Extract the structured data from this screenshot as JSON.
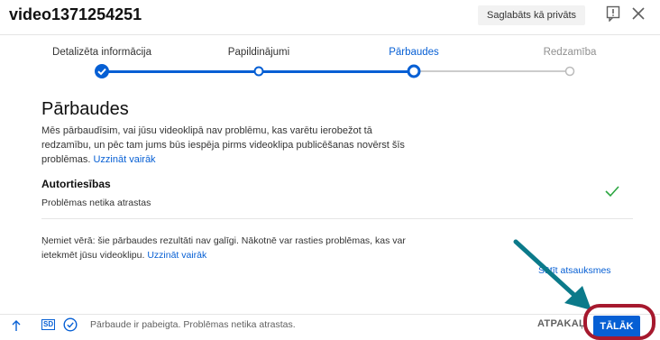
{
  "header": {
    "title": "video1371254251",
    "saved_badge": "Saglabāts kā privāts"
  },
  "stepper": {
    "steps": [
      {
        "label": "Detalizēta informācija",
        "state": "done"
      },
      {
        "label": "Papildinājumi",
        "state": "done"
      },
      {
        "label": "Pārbaudes",
        "state": "active"
      },
      {
        "label": "Redzamība",
        "state": "disabled"
      }
    ]
  },
  "checks": {
    "title": "Pārbaudes",
    "intro": "Mēs pārbaudīsim, vai jūsu videoklipā nav problēmu, kas varētu ierobežot tā redzamību, un pēc tam jums būs iespēja pirms videoklipa publicēšanas novērst šīs problēmas.",
    "intro_link": "Uzzināt vairāk",
    "copyright_title": "Autortiesības",
    "copyright_status": "Problēmas netika atrastas",
    "note": "Ņemiet vērā: šie pārbaudes rezultāti nav galīgi. Nākotnē var rasties problēmas, kas var ietekmēt jūsu videoklipu.",
    "note_link": "Uzzināt vairāk",
    "feedback_link": "Sūtīt atsauksmes"
  },
  "footer": {
    "sd_badge": "SD",
    "status": "Pārbaude ir pabeigta. Problēmas netika atrastas.",
    "back_label": "ATPAKAĻ",
    "next_label": "TĀLĀK"
  },
  "colors": {
    "accent": "#065fd4",
    "success": "#2ba640",
    "annotation_arrow": "#0b7a8a",
    "annotation_ring": "#a6192e"
  }
}
